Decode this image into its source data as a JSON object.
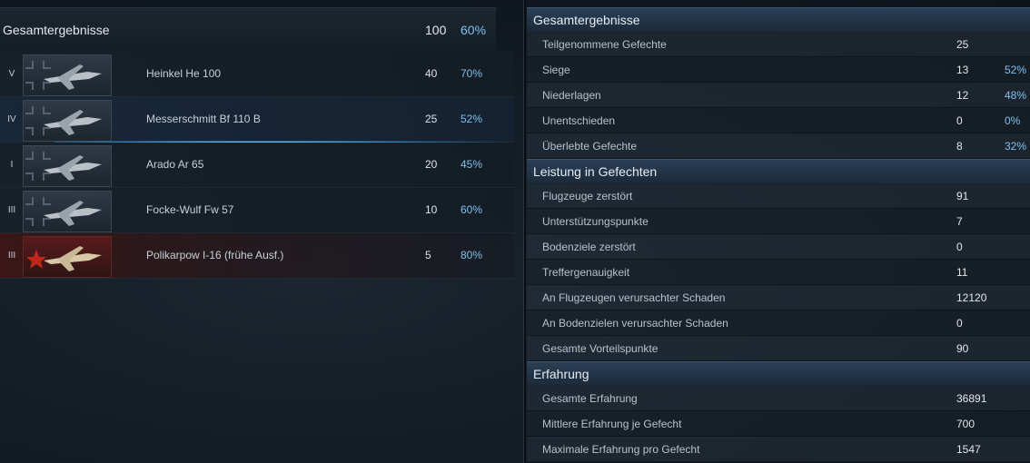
{
  "summary": {
    "title": "Gesamtergebnisse",
    "count": "100",
    "pct": "60%"
  },
  "planes": [
    {
      "tier": "V",
      "name": "Heinkel He 100",
      "count": "40",
      "pct": "70%",
      "nation": "german"
    },
    {
      "tier": "IV",
      "name": "Messerschmitt Bf 110 B",
      "count": "25",
      "pct": "52%",
      "nation": "german"
    },
    {
      "tier": "I",
      "name": "Arado Ar 65",
      "count": "20",
      "pct": "45%",
      "nation": "german"
    },
    {
      "tier": "III",
      "name": "Focke-Wulf Fw 57",
      "count": "10",
      "pct": "60%",
      "nation": "german"
    },
    {
      "tier": "III",
      "name": "Polikarpow I-16 (frühe Ausf.)",
      "count": "5",
      "pct": "80%",
      "nation": "soviet"
    }
  ],
  "sections": [
    {
      "title": "Gesamtergebnisse",
      "rows": [
        {
          "label": "Teilgenommene Gefechte",
          "value": "25",
          "pct": ""
        },
        {
          "label": "Siege",
          "value": "13",
          "pct": "52%"
        },
        {
          "label": "Niederlagen",
          "value": "12",
          "pct": "48%"
        },
        {
          "label": "Unentschieden",
          "value": "0",
          "pct": "0%"
        },
        {
          "label": "Überlebte Gefechte",
          "value": "8",
          "pct": "32%"
        }
      ]
    },
    {
      "title": "Leistung in Gefechten",
      "rows": [
        {
          "label": "Flugzeuge zerstört",
          "value": "91",
          "pct": ""
        },
        {
          "label": "Unterstützungspunkte",
          "value": "7",
          "pct": ""
        },
        {
          "label": "Bodenziele zerstört",
          "value": "0",
          "pct": ""
        },
        {
          "label": "Treffergenauigkeit",
          "value": "11",
          "pct": ""
        },
        {
          "label": "An Flugzeugen verursachter Schaden",
          "value": "12120",
          "pct": ""
        },
        {
          "label": "An Bodenzielen verursachter Schaden",
          "value": "0",
          "pct": ""
        },
        {
          "label": "Gesamte Vorteilspunkte",
          "value": "90",
          "pct": ""
        }
      ]
    },
    {
      "title": "Erfahrung",
      "rows": [
        {
          "label": "Gesamte Erfahrung",
          "value": "36891",
          "pct": ""
        },
        {
          "label": "Mittlere Erfahrung je Gefecht",
          "value": "700",
          "pct": ""
        },
        {
          "label": "Maximale Erfahrung pro Gefecht",
          "value": "1547",
          "pct": ""
        }
      ]
    }
  ],
  "colors": {
    "accent": "#7ec0ee",
    "header_bg": "#2a3f56",
    "soviet_red": "#c0281e"
  },
  "icons": {
    "german_emblem": "balkenkreuz-icon",
    "soviet_emblem": "red-star-icon",
    "plane": "plane-silhouette-icon"
  }
}
